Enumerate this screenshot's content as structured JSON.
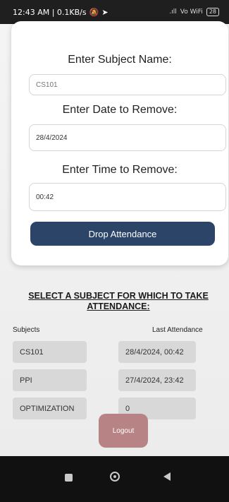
{
  "status_bar": {
    "time_info": "12:43 AM | 0.1KB/s",
    "signal_text": ".ıll",
    "wifi_text": "Vo WiFi",
    "battery": "28"
  },
  "dialog": {
    "subject_label": "Enter Subject Name:",
    "subject_placeholder": "CS101",
    "date_label": "Enter Date to Remove:",
    "date_value": "28/4/2024",
    "time_label": "Enter Time to Remove:",
    "time_value": "00:42",
    "drop_button": "Drop Attendance"
  },
  "main": {
    "section_title": "SELECT A SUBJECT FOR WHICH TO TAKE ATTENDANCE:",
    "col_subjects": "Subjects",
    "col_last": "Last Attendance",
    "rows": [
      {
        "subject": "CS101",
        "last": "28/4/2024, 00:42"
      },
      {
        "subject": "PPI",
        "last": "27/4/2024, 23:42"
      },
      {
        "subject": "OPTIMIZATION",
        "last": "0"
      }
    ],
    "logout": "Logout"
  },
  "colors": {
    "primary_button": "#2b4468",
    "logout_button": "#b88385",
    "row_bg": "#d8d8d8"
  }
}
